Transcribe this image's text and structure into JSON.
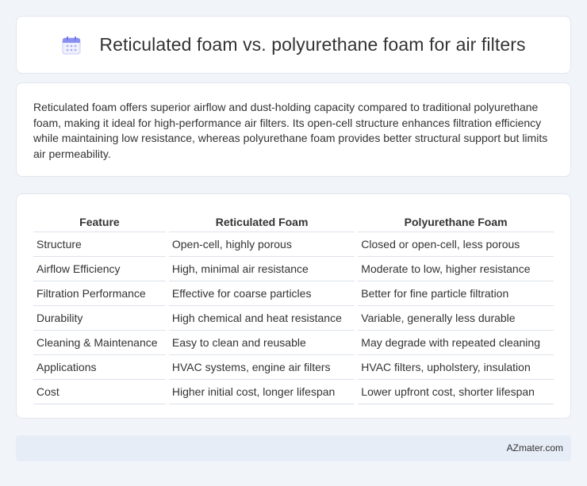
{
  "header": {
    "title": "Reticulated foam vs. polyurethane foam for air filters",
    "icon": "calendar-icon",
    "icon_color": "#7b82f0"
  },
  "summary": {
    "text": "Reticulated foam offers superior airflow and dust-holding capacity compared to traditional polyurethane foam, making it ideal for high-performance air filters. Its open-cell structure enhances filtration efficiency while maintaining low resistance, whereas polyurethane foam provides better structural support but limits air permeability."
  },
  "table": {
    "headers": [
      "Feature",
      "Reticulated Foam",
      "Polyurethane Foam"
    ],
    "rows": [
      [
        "Structure",
        "Open-cell, highly porous",
        "Closed or open-cell, less porous"
      ],
      [
        "Airflow Efficiency",
        "High, minimal air resistance",
        "Moderate to low, higher resistance"
      ],
      [
        "Filtration Performance",
        "Effective for coarse particles",
        "Better for fine particle filtration"
      ],
      [
        "Durability",
        "High chemical and heat resistance",
        "Variable, generally less durable"
      ],
      [
        "Cleaning & Maintenance",
        "Easy to clean and reusable",
        "May degrade with repeated cleaning"
      ],
      [
        "Applications",
        "HVAC systems, engine air filters",
        "HVAC filters, upholstery, insulation"
      ],
      [
        "Cost",
        "Higher initial cost, longer lifespan",
        "Lower upfront cost, shorter lifespan"
      ]
    ]
  },
  "footer": {
    "brand": "AZmater.com"
  },
  "colors": {
    "background": "#f1f4f9",
    "card": "#ffffff",
    "footer_bg": "#e7edf7"
  }
}
